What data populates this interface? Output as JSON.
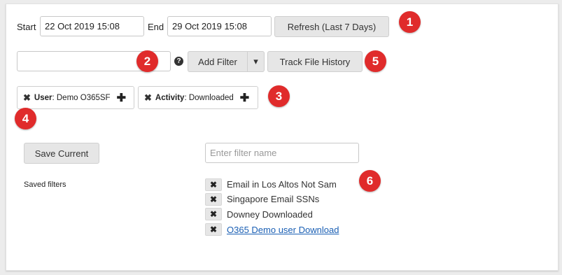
{
  "date_range": {
    "start_label": "Start",
    "start_value": "22 Oct 2019 15:08",
    "end_label": "End",
    "end_value": "29 Oct 2019 15:08",
    "refresh_label": "Refresh (Last 7 Days)"
  },
  "filter_bar": {
    "search_value": "",
    "help_glyph": "?",
    "add_filter_label": "Add Filter",
    "dropdown_glyph": "▾",
    "track_history_label": "Track File History"
  },
  "active_filters": [
    {
      "key": "User",
      "value": ": Demo O365SF"
    },
    {
      "key": "Activity",
      "value": ": Downloaded"
    }
  ],
  "save": {
    "button_label": "Save Current",
    "name_placeholder": "Enter filter name",
    "name_value": ""
  },
  "saved_filters": {
    "label": "Saved filters",
    "items": [
      {
        "name": "Email in Los Altos Not Sam",
        "link": false
      },
      {
        "name": "Singapore Email SSNs",
        "link": false
      },
      {
        "name": "Downey Downloaded",
        "link": false
      },
      {
        "name": "O365 Demo user Download",
        "link": true
      }
    ]
  },
  "icons": {
    "remove": "close-icon",
    "add": "plus-icon",
    "help": "help-icon",
    "dropdown": "caret-down-icon"
  },
  "callouts": [
    "1",
    "2",
    "3",
    "4",
    "5",
    "6"
  ],
  "colors": {
    "callout": "#e02b2b",
    "link": "#1a5fb4",
    "button_bg": "#e6e6e6"
  }
}
